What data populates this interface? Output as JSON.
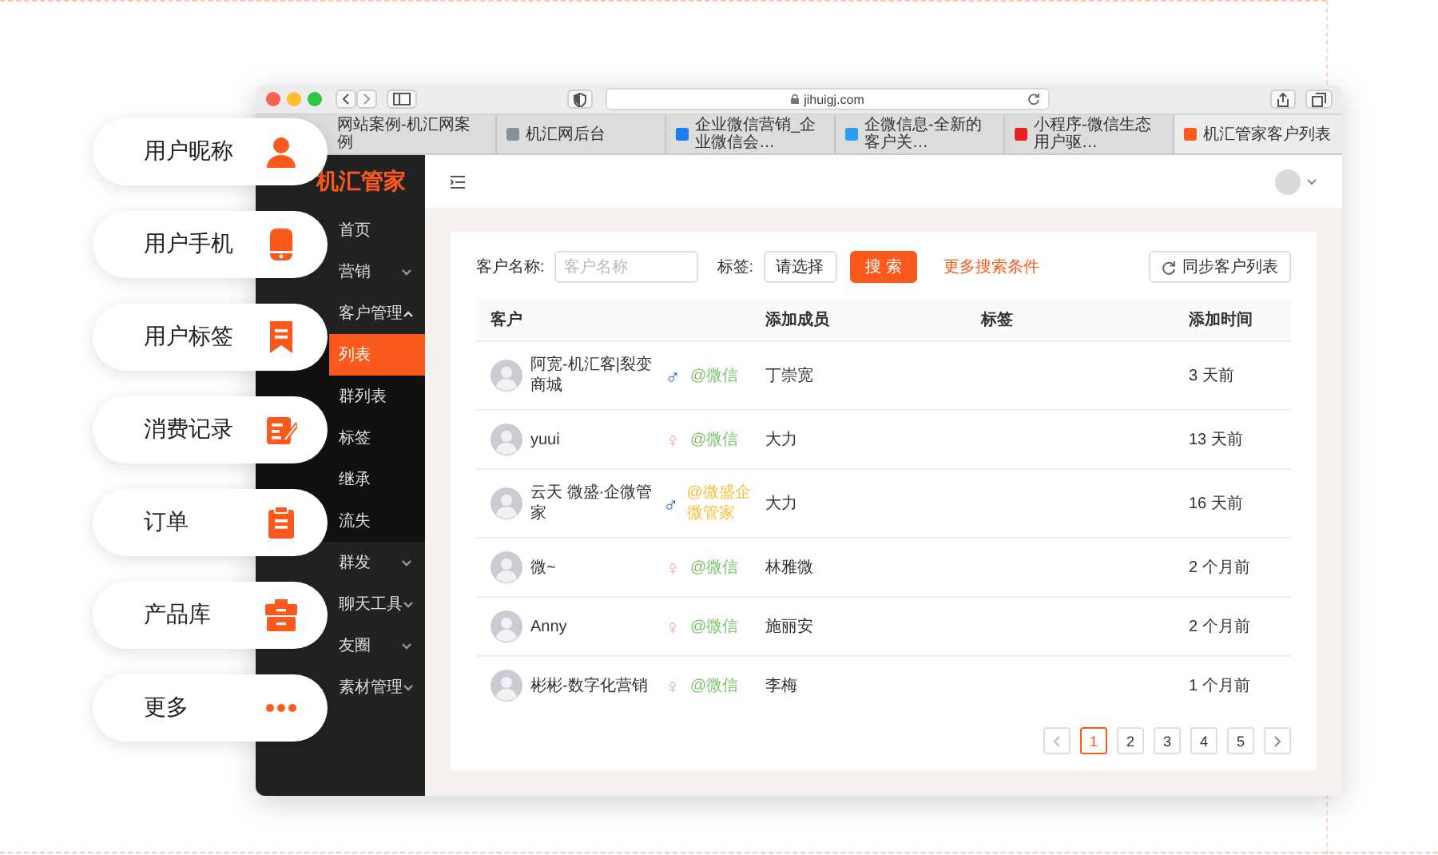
{
  "features": [
    {
      "label": "用户昵称"
    },
    {
      "label": "用户手机"
    },
    {
      "label": "用户标签"
    },
    {
      "label": "消费记录"
    },
    {
      "label": "订单"
    },
    {
      "label": "产品库"
    },
    {
      "label": "更多"
    }
  ],
  "browser": {
    "address": "jihuigj.com",
    "tabs": [
      {
        "label": "网站案例-机汇网案例",
        "selected": false
      },
      {
        "label": "机汇网后台",
        "selected": false
      },
      {
        "label": "企业微信营销_企业微信会…",
        "selected": false
      },
      {
        "label": "企微信息-全新的客户关…",
        "selected": false
      },
      {
        "label": "小程序-微信生态用户驱…",
        "selected": false
      },
      {
        "label": "机汇管家客户列表",
        "selected": true
      }
    ]
  },
  "sidebar": {
    "logo": "机汇管家",
    "items": [
      {
        "label": "首页",
        "kind": "link"
      },
      {
        "label": "营销",
        "kind": "group",
        "expanded": false
      },
      {
        "label": "客户管理",
        "kind": "group",
        "expanded": true,
        "children": [
          {
            "label": "列表",
            "selected": true
          },
          {
            "label": "群列表",
            "selected": false
          },
          {
            "label": "标签",
            "selected": false
          },
          {
            "label": "继承",
            "selected": false
          },
          {
            "label": "流失",
            "selected": false
          }
        ]
      },
      {
        "label": "群发",
        "kind": "group",
        "expanded": false
      },
      {
        "label": "聊天工具",
        "kind": "group",
        "expanded": false
      },
      {
        "label": "友圈",
        "kind": "group",
        "expanded": false
      },
      {
        "label": "素材管理",
        "kind": "group",
        "expanded": false
      }
    ]
  },
  "filters": {
    "name_label": "客户名称:",
    "name_placeholder": "客户名称",
    "tag_label": "标签:",
    "tag_select": "请选择",
    "search_button": "搜 索",
    "more_link": "更多搜索条件",
    "sync_button": "同步客户列表"
  },
  "table": {
    "columns": [
      "客户",
      "添加成员",
      "标签",
      "添加时间"
    ],
    "rows": [
      {
        "name": "阿宽-机汇客|裂变商城",
        "gender": {
          "symbol": "♂",
          "color": "#2f54eb"
        },
        "source": {
          "text": "@微信",
          "color": "#7cc46c"
        },
        "member": "丁崇宽",
        "time": "3 天前"
      },
      {
        "name": "yuui",
        "gender": {
          "symbol": "♀",
          "color": "#f5a3b7"
        },
        "source": {
          "text": "@微信",
          "color": "#7cc46c"
        },
        "member": "大力",
        "time": "13 天前"
      },
      {
        "name": "云天 微盛·企微管家",
        "gender": {
          "symbol": "♂",
          "color": "#2f54eb"
        },
        "source": {
          "text": "@微盛企微管家",
          "color": "#f5c13a"
        },
        "member": "大力",
        "time": "16 天前"
      },
      {
        "name": "微~",
        "gender": {
          "symbol": "♀",
          "color": "#f5a3b7"
        },
        "source": {
          "text": "@微信",
          "color": "#7cc46c"
        },
        "member": "林雅微",
        "time": "2 个月前"
      },
      {
        "name": "Anny",
        "gender": {
          "symbol": "♀",
          "color": "#f5a3b7"
        },
        "source": {
          "text": "@微信",
          "color": "#7cc46c"
        },
        "member": "施丽安",
        "time": "2 个月前"
      },
      {
        "name": "彬彬-数字化营销",
        "gender": {
          "symbol": "♀",
          "color": "#f5a3b7"
        },
        "source": {
          "text": "@微信",
          "color": "#7cc46c"
        },
        "member": "李梅",
        "time": "1 个月前"
      }
    ]
  },
  "pagination": {
    "pages": [
      {
        "label": "1",
        "selected": true
      },
      {
        "label": "2",
        "selected": false
      },
      {
        "label": "3",
        "selected": false
      },
      {
        "label": "4",
        "selected": false
      },
      {
        "label": "5",
        "selected": false
      }
    ]
  }
}
